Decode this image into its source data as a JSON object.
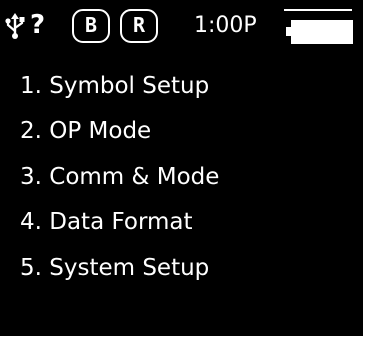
{
  "status_bar": {
    "usb_icon": "usb-icon",
    "unknown_indicator": "?",
    "badges": [
      "B",
      "R"
    ],
    "time": "1:00P",
    "battery_level": 1.0
  },
  "menu": {
    "items": [
      {
        "label": "1. Symbol Setup"
      },
      {
        "label": "2. OP Mode"
      },
      {
        "label": "3. Comm & Mode"
      },
      {
        "label": "4. Data Format"
      },
      {
        "label": "5. System Setup"
      }
    ]
  },
  "colors": {
    "background": "#000000",
    "foreground": "#ffffff"
  }
}
